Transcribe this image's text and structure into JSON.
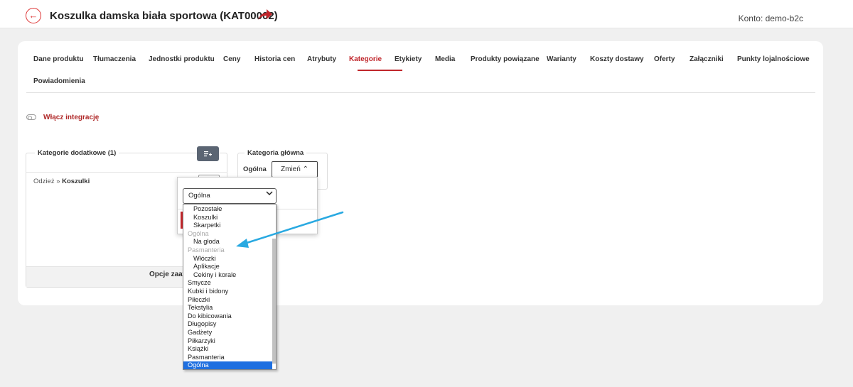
{
  "header": {
    "back_icon": "arrow-left-icon",
    "title": "Koszulka damska biała sportowa (KAT00002)",
    "share_icon": "share-arrow-icon",
    "account": "Konto: demo-b2c"
  },
  "tabs": [
    {
      "label": "Dane produktu",
      "active": false
    },
    {
      "label": "Tłumaczenia",
      "active": false
    },
    {
      "label": "Jednostki produktu",
      "active": false
    },
    {
      "label": "Ceny",
      "active": false
    },
    {
      "label": "Historia cen",
      "active": false
    },
    {
      "label": "Atrybuty",
      "active": false
    },
    {
      "label": "Kategorie",
      "active": true
    },
    {
      "label": "Etykiety",
      "active": false
    },
    {
      "label": "Media",
      "active": false
    },
    {
      "label": "Produkty powiązane",
      "active": false
    },
    {
      "label": "Warianty",
      "active": false
    },
    {
      "label": "Koszty dostawy",
      "active": false
    },
    {
      "label": "Oferty",
      "active": false
    },
    {
      "label": "Załączniki",
      "active": false
    },
    {
      "label": "Punkty lojalnościowe",
      "active": false
    },
    {
      "label": "Powiadomienia",
      "active": false
    }
  ],
  "integration": {
    "toggle_icon": "toggle-off-icon",
    "label": "Włącz integrację"
  },
  "additional_categories": {
    "legend": "Kategorie dodatkowe (1)",
    "add_icon": "add-list-icon",
    "item_path": "Odzież »",
    "item_name": "Koszulki",
    "footer": "Opcje zaaw"
  },
  "main_category": {
    "legend": "Kategoria główna",
    "value": "Ogólna",
    "change_label": "Zmień ⌃"
  },
  "popover": {
    "select_value": "Ogólna",
    "options": [
      {
        "label": "Pozostałe",
        "indent": 2,
        "kind": "item"
      },
      {
        "label": "Koszulki",
        "indent": 2,
        "kind": "item"
      },
      {
        "label": "Skarpetki",
        "indent": 2,
        "kind": "item"
      },
      {
        "label": "Ogólna",
        "indent": 1,
        "kind": "group"
      },
      {
        "label": "Na głoda",
        "indent": 2,
        "kind": "item"
      },
      {
        "label": "Pasmanteria",
        "indent": 1,
        "kind": "group"
      },
      {
        "label": "Włóczki",
        "indent": 2,
        "kind": "item"
      },
      {
        "label": "Aplikacje",
        "indent": 2,
        "kind": "item"
      },
      {
        "label": "Cekiny i korale",
        "indent": 2,
        "kind": "item"
      },
      {
        "label": "Smycze",
        "indent": 1,
        "kind": "item"
      },
      {
        "label": "Kubki i bidony",
        "indent": 1,
        "kind": "item"
      },
      {
        "label": "Piłeczki",
        "indent": 1,
        "kind": "item"
      },
      {
        "label": "Tekstylia",
        "indent": 1,
        "kind": "item"
      },
      {
        "label": "Do kibicowania",
        "indent": 1,
        "kind": "item"
      },
      {
        "label": "Długopisy",
        "indent": 1,
        "kind": "item"
      },
      {
        "label": "Gadżety",
        "indent": 1,
        "kind": "item"
      },
      {
        "label": "Piłkarzyki",
        "indent": 1,
        "kind": "item"
      },
      {
        "label": "Książki",
        "indent": 1,
        "kind": "item"
      },
      {
        "label": "Pasmanteria",
        "indent": 1,
        "kind": "item"
      },
      {
        "label": "Ogólna",
        "indent": 1,
        "kind": "selected"
      }
    ]
  },
  "colors": {
    "accent": "#c0262b",
    "selected": "#1e6fe0",
    "annotation": "#29a9e1"
  }
}
